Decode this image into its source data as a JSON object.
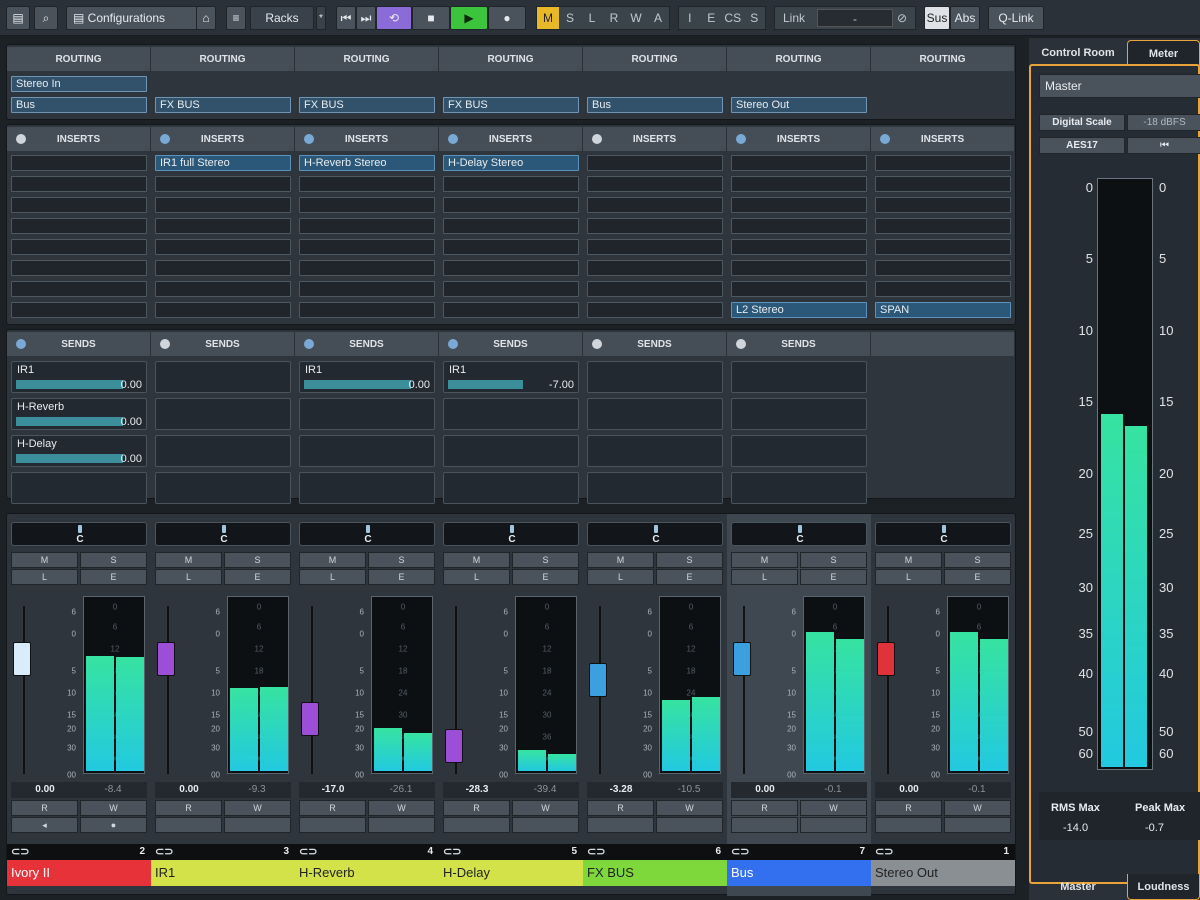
{
  "toolbar": {
    "configurations": "Configurations",
    "racks": "Racks",
    "star": "*",
    "modes": [
      "M",
      "S",
      "L",
      "R",
      "W",
      "A"
    ],
    "modes2": [
      "I",
      "E",
      "CS",
      "S"
    ],
    "link": "Link",
    "link_value": "-",
    "sus": "Sus",
    "abs": "Abs",
    "qlink": "Q-Link"
  },
  "routing_header": "ROUTING",
  "inserts_header": "INSERTS",
  "sends_header": "SENDS",
  "routing_in": [
    "Stereo In",
    "",
    "",
    "",
    "",
    "",
    ""
  ],
  "routing_out": [
    "Bus",
    "FX BUS",
    "FX BUS",
    "FX BUS",
    "Bus",
    "Stereo Out",
    ""
  ],
  "insert_slots": [
    [
      "",
      "",
      "",
      "",
      "",
      "",
      "",
      ""
    ],
    [
      "IR1 full Stereo",
      "",
      "",
      "",
      "",
      "",
      "",
      ""
    ],
    [
      "H-Reverb Stereo",
      "",
      "",
      "",
      "",
      "",
      "",
      ""
    ],
    [
      "H-Delay Stereo",
      "",
      "",
      "",
      "",
      "",
      "",
      ""
    ],
    [
      "",
      "",
      "",
      "",
      "",
      "",
      "",
      ""
    ],
    [
      "",
      "",
      "",
      "",
      "",
      "",
      "",
      "L2 Stereo"
    ],
    [
      "",
      "",
      "",
      "",
      "",
      "",
      "",
      "SPAN"
    ]
  ],
  "insert_dot_on": [
    false,
    true,
    true,
    true,
    false,
    true,
    true
  ],
  "sends": [
    [
      {
        "n": "IR1",
        "v": "0.00",
        "f": 0.79
      },
      {
        "n": "H-Reverb",
        "v": "0.00",
        "f": 0.79
      },
      {
        "n": "H-Delay",
        "v": "0.00",
        "f": 0.79
      }
    ],
    [],
    [
      {
        "n": "IR1",
        "v": "0.00",
        "f": 0.79
      }
    ],
    [
      {
        "n": "IR1",
        "v": "-7.00",
        "f": 0.55
      }
    ],
    [],
    [],
    []
  ],
  "sends_dot_on": [
    true,
    false,
    true,
    true,
    false,
    false
  ],
  "strips": [
    {
      "name": "Ivory II",
      "num": "2",
      "color": "#e8323a",
      "fader": "0.00",
      "peak": "-8.4",
      "cap": "#d9ecfb",
      "fpos": 0.2,
      "m": [
        0.67,
        0.66
      ]
    },
    {
      "name": "IR1",
      "num": "3",
      "color": "#d4e249",
      "fader": "0.00",
      "peak": "-9.3",
      "cap": "#9a4fd6",
      "fpos": 0.2,
      "m": [
        0.48,
        0.49
      ]
    },
    {
      "name": "H-Reverb",
      "num": "4",
      "color": "#d4e249",
      "fader": "-17.0",
      "peak": "-26.1",
      "cap": "#9a4fd6",
      "fpos": 0.6,
      "m": [
        0.25,
        0.22
      ]
    },
    {
      "name": "H-Delay",
      "num": "5",
      "color": "#d4e249",
      "fader": "-28.3",
      "peak": "-39.4",
      "cap": "#9a4fd6",
      "fpos": 0.78,
      "m": [
        0.12,
        0.1
      ]
    },
    {
      "name": "FX BUS",
      "num": "6",
      "color": "#7fd83b",
      "fader": "-3.28",
      "peak": "-10.5",
      "cap": "#3aa0e0",
      "fpos": 0.34,
      "m": [
        0.41,
        0.43
      ]
    },
    {
      "name": "Bus",
      "num": "7",
      "color": "#3370f0",
      "fader": "0.00",
      "peak": "-0.1",
      "cap": "#3aa0e0",
      "fpos": 0.2,
      "m": [
        0.81,
        0.77
      ]
    },
    {
      "name": "Stereo Out",
      "num": "1",
      "color": "#8a8f94",
      "fader": "0.00",
      "peak": "-0.1",
      "cap": "#e0323a",
      "fpos": 0.2,
      "m": [
        0.81,
        0.77
      ]
    }
  ],
  "fader_scale": [
    "6",
    "0",
    "5",
    "10",
    "15",
    "20",
    "30",
    "00"
  ],
  "meter_scale": [
    "0",
    "6",
    "12",
    "18",
    "24",
    "30",
    "36",
    "00"
  ],
  "pan_label": "C",
  "right": {
    "tab1": "Control Room",
    "tab2": "Meter",
    "master": "Master",
    "digital": "Digital Scale",
    "dbfs": "-18 dBFS",
    "aes": "AES17",
    "ticks": [
      "0",
      "5",
      "10",
      "15",
      "20",
      "25",
      "30",
      "35",
      "40",
      "50",
      "60"
    ],
    "rms_label": "RMS Max",
    "peak_label": "Peak Max",
    "rms": "-14.0",
    "peak": "-0.7",
    "btab1": "Master",
    "btab2": "Loudness",
    "levels": [
      0.6,
      0.58
    ]
  }
}
